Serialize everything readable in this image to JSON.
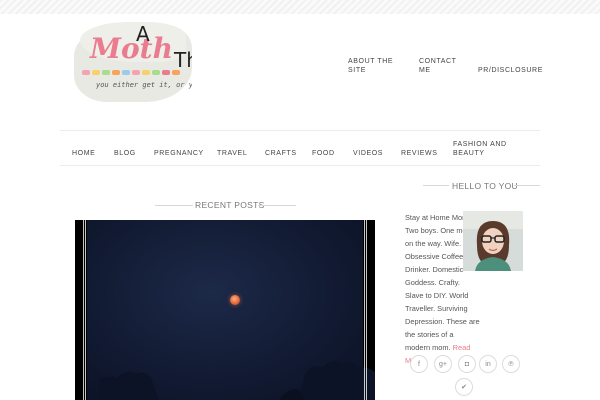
{
  "logo": {
    "title_text": "Moth",
    "letter_a": "A",
    "letter_th": "Th",
    "tagline": "you either get it, or y",
    "dot_colors": [
      "#f4a3b3",
      "#f7d26b",
      "#a9dc8c",
      "#f7a35c",
      "#9ccbe8",
      "#f4a3b3",
      "#f7d26b",
      "#a9dc8c",
      "#e97c8e",
      "#f7a35c"
    ]
  },
  "top_links": [
    {
      "label_line1": "ABOUT THE",
      "label_line2": "SITE"
    },
    {
      "label_line1": "CONTACT",
      "label_line2": "ME"
    },
    {
      "label_line1": "PR/DISCLOSURE",
      "label_line2": ""
    }
  ],
  "nav": {
    "items": [
      {
        "label": "HOME"
      },
      {
        "label": "BLOG"
      },
      {
        "label": "PREGNANCY"
      },
      {
        "label": "TRAVEL"
      },
      {
        "label": "CRAFTS"
      },
      {
        "label": "FOOD"
      },
      {
        "label": "VIDEOS"
      },
      {
        "label": "REVIEWS"
      },
      {
        "label_line1": "FASHION AND",
        "label_line2": "BEAUTY"
      }
    ]
  },
  "main": {
    "section_title": "RECENT POSTS"
  },
  "sidebar": {
    "title": "HELLO TO YOU",
    "about": "Stay at Home Mom. Two boys. One more on the way. Wife. Obsessive Coffee Drinker. Domestic Goddess. Crafty. Slave to DIY. World Traveller. Surviving Depression. These are the stories of a modern mom.",
    "read_more": "Read More...",
    "social": [
      {
        "icon": "facebook-icon",
        "glyph": "f"
      },
      {
        "icon": "google-plus-icon",
        "glyph": "g+"
      },
      {
        "icon": "instagram-icon",
        "glyph": "◘"
      },
      {
        "icon": "linkedin-icon",
        "glyph": "in"
      },
      {
        "icon": "pinterest-icon",
        "glyph": "℗"
      },
      {
        "icon": "twitter-icon",
        "glyph": "✔"
      }
    ]
  },
  "colors": {
    "accent": "#e97c8e",
    "image_sky": "#121b33",
    "moon": "#e0623a"
  }
}
